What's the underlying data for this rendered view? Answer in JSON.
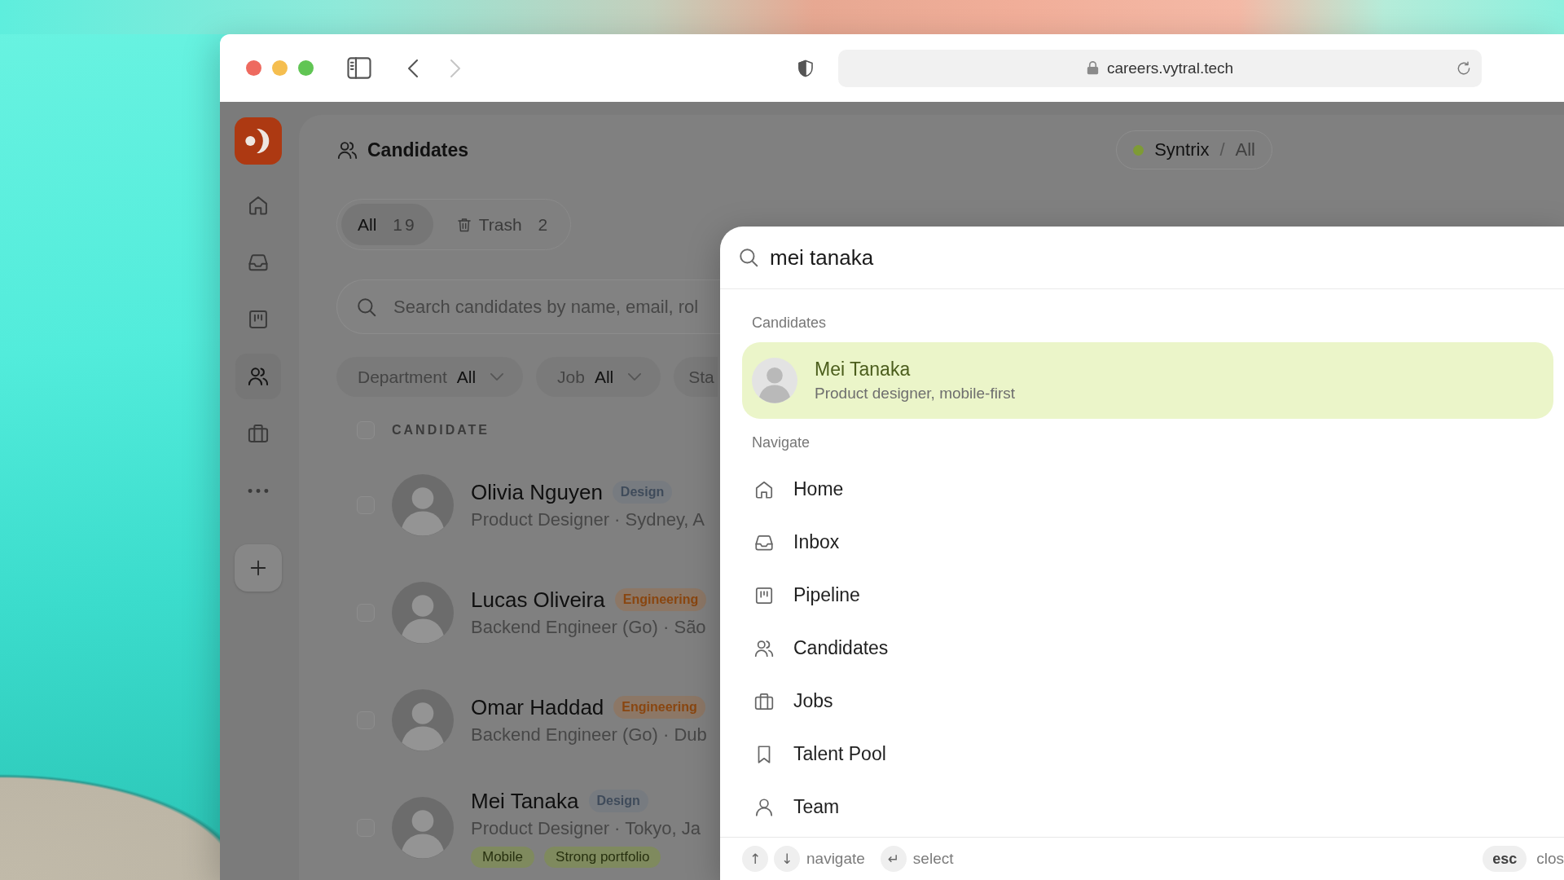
{
  "browser": {
    "url": "careers.vytral.tech",
    "back_enabled": true,
    "forward_enabled": false
  },
  "sidebar": {
    "items": [
      {
        "kind": "home",
        "selected": false
      },
      {
        "kind": "inbox",
        "selected": false
      },
      {
        "kind": "pipeline",
        "selected": false
      },
      {
        "kind": "people",
        "selected": true
      },
      {
        "kind": "briefcase",
        "selected": false
      },
      {
        "kind": "more",
        "selected": false
      }
    ]
  },
  "header": {
    "title": "Candidates",
    "workspace": "Syntrix",
    "separator": "/",
    "scope": "All"
  },
  "tabs": [
    {
      "kind": "plain",
      "label": "All",
      "count": "19",
      "selected": true
    },
    {
      "kind": "trash",
      "label": "Trash",
      "count": "2",
      "selected": false
    }
  ],
  "search": {
    "placeholder": "Search candidates by name, email, rol"
  },
  "filters": [
    {
      "label": "Department",
      "value": "All"
    },
    {
      "label": "Job",
      "value": "All"
    },
    {
      "label": "Sta"
    }
  ],
  "table": {
    "columns": [
      "CANDIDATE"
    ],
    "all_checked": false,
    "rows": [
      {
        "name": "Olivia Nguyen",
        "checked": false,
        "department": {
          "label": "Design",
          "color": "#777b80"
        },
        "subtitle": "Product Designer · Sydney, A"
      },
      {
        "name": "Lucas Oliveira",
        "checked": false,
        "department": {
          "label": "Engineering",
          "color": "#8c7766"
        },
        "subtitle": "Backend Engineer (Go) · São"
      },
      {
        "name": "Omar Haddad",
        "checked": false,
        "department": {
          "label": "Engineering",
          "color": "#8c7766"
        },
        "subtitle": "Backend Engineer (Go) · Dub"
      },
      {
        "name": "Mei Tanaka",
        "checked": false,
        "department": {
          "label": "Design",
          "color": "#777b80"
        },
        "subtitle": "Product Designer · Tokyo, Ja",
        "tags": [
          "Mobile",
          "Strong portfolio"
        ]
      }
    ]
  },
  "command_palette": {
    "query": "mei tanaka",
    "sections": [
      {
        "title": "Candidates",
        "items": [
          {
            "kind": "avatar",
            "title": "Mei Tanaka",
            "subtitle": "Product designer, mobile-first",
            "selected": true
          }
        ]
      },
      {
        "title": "Navigate",
        "items": [
          {
            "kind": "home",
            "title": "Home",
            "selected": false
          },
          {
            "kind": "inbox",
            "title": "Inbox",
            "selected": false
          },
          {
            "kind": "pipeline",
            "title": "Pipeline",
            "selected": false
          },
          {
            "kind": "people",
            "title": "Candidates",
            "selected": false
          },
          {
            "kind": "briefcase",
            "title": "Jobs",
            "selected": false
          },
          {
            "kind": "bookmark",
            "title": "Talent Pool",
            "selected": false
          },
          {
            "kind": "person",
            "title": "Team",
            "selected": false
          }
        ]
      }
    ],
    "hints": [
      {
        "keys": [
          "↑",
          "↓"
        ],
        "label": "navigate"
      },
      {
        "keys": [
          "↵"
        ],
        "label": "select"
      }
    ],
    "close_hint": {
      "key": "esc",
      "label": "clos"
    }
  }
}
